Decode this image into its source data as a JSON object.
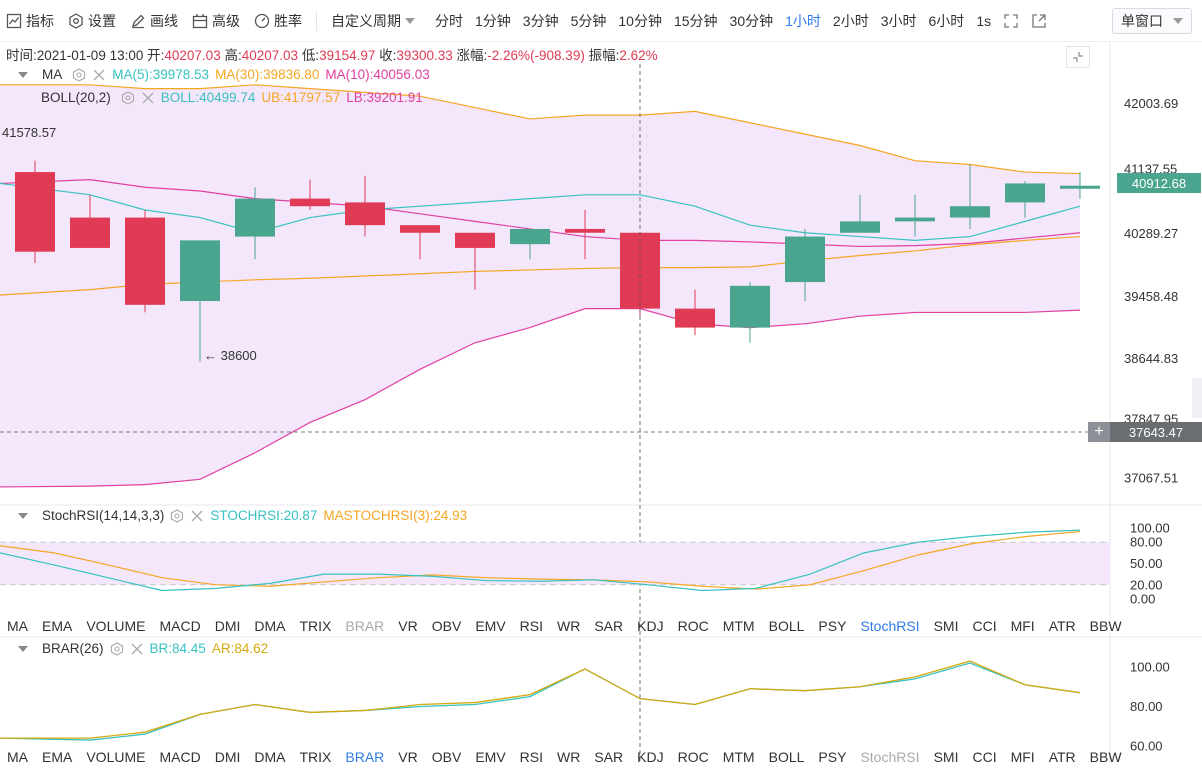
{
  "toolbar": {
    "indicator_label": "指标",
    "settings_label": "设置",
    "draw_label": "画线",
    "advanced_label": "高级",
    "winrate_label": "胜率",
    "custom_period_label": "自定义周期",
    "periods": [
      "分时",
      "1分钟",
      "3分钟",
      "5分钟",
      "10分钟",
      "15分钟",
      "30分钟",
      "1小时",
      "2小时",
      "3小时",
      "6小时",
      "1s"
    ],
    "active_period": "1小时",
    "window_select": "单窗口"
  },
  "info_bar": {
    "time_label": "时间:",
    "time_value": "2021-01-09 13:00",
    "open_label": "开:",
    "open_value": "40207.03",
    "high_label": "高:",
    "high_value": "40207.03",
    "low_label": "低:",
    "low_value": "39154.97",
    "close_label": "收:",
    "close_value": "39300.33",
    "change_label": "涨幅:",
    "change_value": "-2.26%(-908.39)",
    "amp_label": "振幅:",
    "amp_value": "2.62%"
  },
  "ma_legend": {
    "name": "MA",
    "ma5": "MA(5):39978.53",
    "ma30": "MA(30):39836.80",
    "ma10": "MA(10):40056.03"
  },
  "boll_legend": {
    "name": "BOLL(20,2)",
    "boll": "BOLL:40499.74",
    "ub": "UB:41797.57",
    "lb": "LB:39201.91"
  },
  "main_axis": [
    "42003.69",
    "41137.55",
    "40289.27",
    "39458.48",
    "38644.83",
    "37847.95",
    "37067.51"
  ],
  "current_price": "40912.68",
  "crosshair_price": "37643.47",
  "high_mark": "41578.57",
  "low_mark": "← 38600",
  "stochrsi_legend": {
    "name": "StochRSI(14,14,3,3)",
    "stochrsi": "STOCHRSI:20.87",
    "mastochrsi": "MASTOCHRSI(3):24.93"
  },
  "stoch_axis": [
    "100.00",
    "80.00",
    "50.00",
    "20.00",
    "0.00"
  ],
  "brar_legend": {
    "name": "BRAR(26)",
    "br": "BR:84.45",
    "ar": "AR:84.62"
  },
  "brar_axis": [
    "100.00",
    "80.00",
    "60.00"
  ],
  "indicator_tabs": [
    "MA",
    "EMA",
    "VOLUME",
    "MACD",
    "DMI",
    "DMA",
    "TRIX",
    "BRAR",
    "VR",
    "OBV",
    "EMV",
    "RSI",
    "WR",
    "SAR",
    "KDJ",
    "ROC",
    "MTM",
    "BOLL",
    "PSY",
    "StochRSI",
    "SMI",
    "CCI",
    "MFI",
    "ATR",
    "BBW"
  ],
  "colors": {
    "up": "#4aa58e",
    "down": "#e03b54",
    "ma5": "#37c2c0",
    "ma30": "#f5a623",
    "ma10": "#e040a0",
    "boll_fill": "#f4e6fb",
    "accent": "#2f7ce8"
  },
  "chart_data": {
    "type": "candlestick",
    "candles": [
      {
        "o": 41100,
        "c": 40050,
        "h": 41250,
        "l": 39900
      },
      {
        "o": 40500,
        "c": 40100,
        "h": 40800,
        "l": 40100
      },
      {
        "o": 40500,
        "c": 39350,
        "h": 40600,
        "l": 39250
      },
      {
        "o": 39400,
        "c": 40200,
        "h": 40200,
        "l": 38600
      },
      {
        "o": 40250,
        "c": 40750,
        "h": 40900,
        "l": 39950
      },
      {
        "o": 40750,
        "c": 40650,
        "h": 41000,
        "l": 40600
      },
      {
        "o": 40700,
        "c": 40400,
        "h": 41050,
        "l": 40250
      },
      {
        "o": 40400,
        "c": 40300,
        "h": 40400,
        "l": 39950
      },
      {
        "o": 40300,
        "c": 40100,
        "h": 40300,
        "l": 39550
      },
      {
        "o": 40150,
        "c": 40350,
        "h": 40350,
        "l": 39950
      },
      {
        "o": 40350,
        "c": 40300,
        "h": 40600,
        "l": 39950
      },
      {
        "o": 40300,
        "c": 39300,
        "h": 40300,
        "l": 39200
      },
      {
        "o": 39300,
        "c": 39050,
        "h": 39550,
        "l": 38950
      },
      {
        "o": 39050,
        "c": 39600,
        "h": 39650,
        "l": 38850
      },
      {
        "o": 39650,
        "c": 40250,
        "h": 40350,
        "l": 39400
      },
      {
        "o": 40300,
        "c": 40450,
        "h": 40800,
        "l": 40300
      },
      {
        "o": 40450,
        "c": 40500,
        "h": 40800,
        "l": 40250
      },
      {
        "o": 40500,
        "c": 40650,
        "h": 41200,
        "l": 40350
      },
      {
        "o": 40700,
        "c": 40950,
        "h": 40980,
        "l": 40500
      },
      {
        "o": 40880,
        "c": 40920,
        "h": 41100,
        "l": 40750
      }
    ],
    "ma5": [
      40950,
      40800,
      40600,
      40500,
      40300,
      40500,
      40600,
      40650,
      40700,
      40750,
      40800,
      40800,
      40650,
      40400,
      40300,
      40250,
      40200,
      40250,
      40450,
      40650
    ],
    "ma10": [
      40950,
      41000,
      40900,
      40850,
      40750,
      40700,
      40650,
      40550,
      40450,
      40350,
      40250,
      40200,
      40200,
      40180,
      40150,
      40120,
      40130,
      40160,
      40230,
      40300
    ],
    "ma30": [
      39480,
      39550,
      39620,
      39650,
      39680,
      39700,
      39730,
      39760,
      39790,
      39810,
      39830,
      39840,
      39840,
      39850,
      39930,
      40000,
      40060,
      40140,
      40200,
      40250
    ],
    "ub": [
      42250,
      42250,
      42200,
      42200,
      42250,
      42200,
      42150,
      42100,
      41950,
      41800,
      41850,
      41850,
      41900,
      41750,
      41600,
      41450,
      41250,
      41200,
      41100,
      41080
    ],
    "lb": [
      36950,
      36960,
      36980,
      37050,
      37400,
      37800,
      38100,
      38500,
      38850,
      39050,
      39300,
      39300,
      39100,
      39050,
      39100,
      39200,
      39250,
      39250,
      39250,
      39280
    ],
    "stoch": [
      65,
      48,
      30,
      12,
      15,
      22,
      35,
      35,
      32,
      26,
      25,
      27,
      20,
      12,
      15,
      35,
      65,
      80,
      88,
      94,
      97
    ],
    "mastoch": [
      75,
      65,
      48,
      30,
      20,
      18,
      24,
      30,
      34,
      30,
      28,
      27,
      24,
      18,
      14,
      20,
      40,
      62,
      78,
      88,
      95
    ],
    "br": [
      64,
      63,
      66,
      76,
      81,
      77,
      78,
      80,
      81,
      85,
      99,
      84,
      81,
      89,
      88,
      90,
      94,
      102,
      91,
      87
    ],
    "ar": [
      64,
      64,
      67,
      76,
      81,
      77,
      78,
      81,
      82,
      86,
      99,
      84,
      81,
      89,
      88,
      90,
      95,
      103,
      91,
      87
    ]
  }
}
